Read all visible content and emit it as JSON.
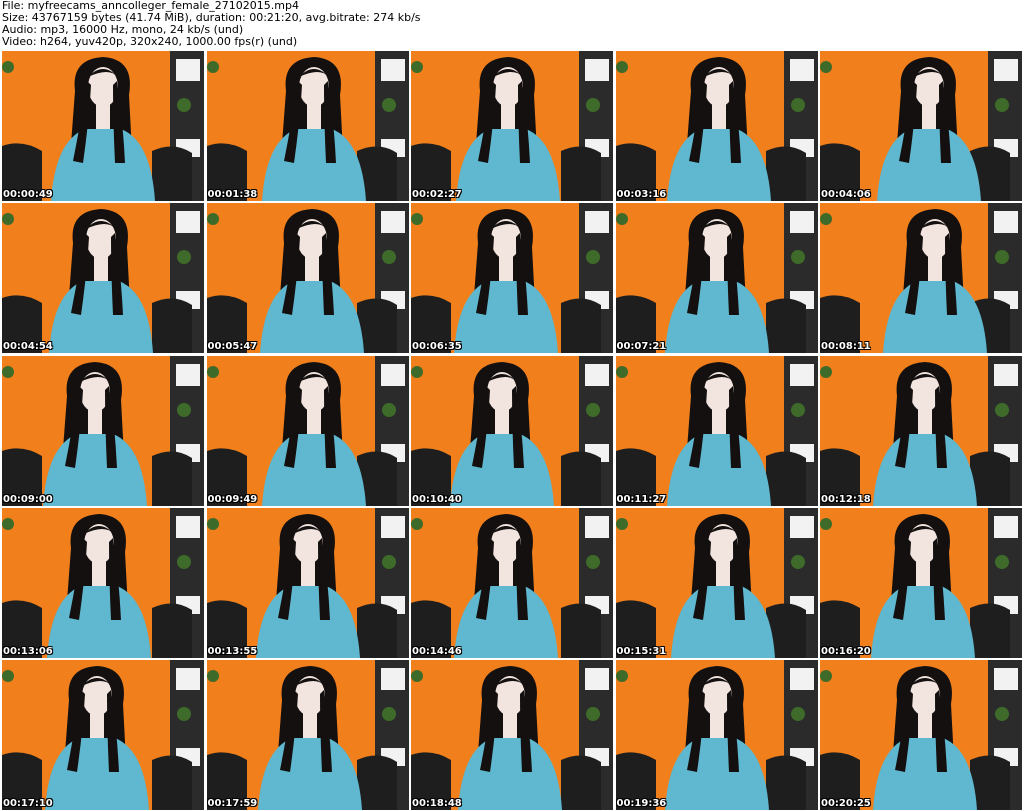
{
  "header": {
    "file_line": "File: myfreecams_anncolleger_female_27102015.mp4",
    "size_line": "Size: 43767159 bytes (41.74 MiB), duration: 00:21:20, avg.bitrate: 274 kb/s",
    "audio_line": "Audio: mp3, 16000 Hz, mono, 24 kb/s (und)",
    "video_line": "Video: h264, yuv420p, 320x240, 1000.00 fps(r) (und)"
  },
  "thumbnails": [
    {
      "timestamp": "00:00:49"
    },
    {
      "timestamp": "00:01:38"
    },
    {
      "timestamp": "00:02:27"
    },
    {
      "timestamp": "00:03:16"
    },
    {
      "timestamp": "00:04:06"
    },
    {
      "timestamp": "00:04:54"
    },
    {
      "timestamp": "00:05:47"
    },
    {
      "timestamp": "00:06:35"
    },
    {
      "timestamp": "00:07:21"
    },
    {
      "timestamp": "00:08:11"
    },
    {
      "timestamp": "00:09:00"
    },
    {
      "timestamp": "00:09:49"
    },
    {
      "timestamp": "00:10:40"
    },
    {
      "timestamp": "00:11:27"
    },
    {
      "timestamp": "00:12:18"
    },
    {
      "timestamp": "00:13:06"
    },
    {
      "timestamp": "00:13:55"
    },
    {
      "timestamp": "00:14:46"
    },
    {
      "timestamp": "00:15:31"
    },
    {
      "timestamp": "00:16:20"
    },
    {
      "timestamp": "00:17:10"
    },
    {
      "timestamp": "00:17:59"
    },
    {
      "timestamp": "00:18:48"
    },
    {
      "timestamp": "00:19:36"
    },
    {
      "timestamp": "00:20:25"
    }
  ],
  "colors": {
    "wall": "#f07f1c",
    "shelf": "#2b2b2b",
    "sofa": "#1e1e1e",
    "shirt": "#5fb8cf",
    "skin": "#f2e4de",
    "hair": "#141010",
    "box": "#f2f2f2"
  }
}
